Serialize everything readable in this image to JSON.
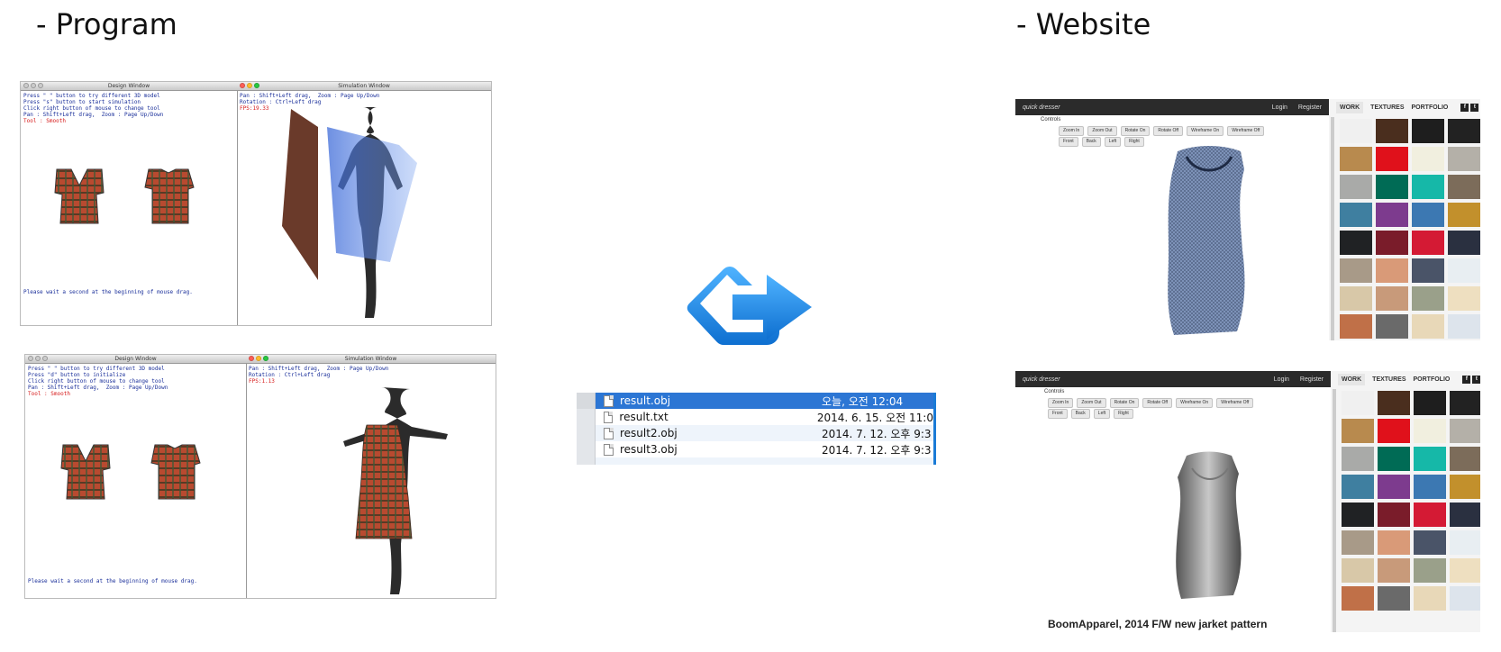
{
  "headings": {
    "program": "- Program",
    "website": "- Website"
  },
  "program_windows": [
    {
      "design_title": "Design Window",
      "design_lines": [
        "Press \" \" button to try different 3D model",
        "Press \"s\" button to start simulation",
        "Click right button of mouse to change tool",
        "Pan : Shift+Left drag,  Zoom : Page Up/Down"
      ],
      "tool_line": "Tool : Smooth",
      "footer": "Please wait a second at the beginning of mouse drag.",
      "sim_title": "Simulation Window",
      "sim_lines": [
        "Pan : Shift+Left drag,  Zoom : Page Up/Down",
        "Rotation : Ctrl+Left drag"
      ],
      "fps": "FPS:19.33"
    },
    {
      "design_title": "Design Window",
      "design_lines": [
        "Press \" \" button to try different 3D model",
        "Press \"d\" button to initialize",
        "Click right button of mouse to change tool",
        "Pan : Shift+Left drag,  Zoom : Page Up/Down"
      ],
      "tool_line": "Tool : Smooth",
      "footer": "Please wait a second at the beginning of mouse drag.",
      "sim_title": "Simulation Window",
      "sim_lines": [
        "Pan : Shift+Left drag,  Zoom : Page Up/Down",
        "Rotation : Ctrl+Left drag"
      ],
      "fps": "FPS:1.13"
    }
  ],
  "files": [
    {
      "name": "result.obj",
      "date": "오늘, 오전 12:04",
      "selected": true
    },
    {
      "name": "result.txt",
      "date": "2014. 6. 15. 오전 11:0"
    },
    {
      "name": "result2.obj",
      "date": "2014. 7. 12. 오후 9:3"
    },
    {
      "name": "result3.obj",
      "date": "2014. 7. 12. 오후 9:3"
    }
  ],
  "website": {
    "brand": "quick dresser",
    "login": "Login",
    "register": "Register",
    "controls_label": "Controls",
    "controls_row1": [
      "Zoom In",
      "Zoom Out",
      "Rotate On",
      "Rotate Off",
      "Wireframe On",
      "Wireframe Off"
    ],
    "controls_row2": [
      "Front",
      "Back",
      "Left",
      "Right"
    ],
    "nav": [
      "WORK",
      "TEXTURES",
      "PORTFOLIO"
    ],
    "social": [
      "f",
      "t"
    ],
    "swatches": [
      "#f0f0f0",
      "#4a2e1e",
      "#1e1e1e",
      "#222222",
      "#b88a4e",
      "#e0111b",
      "#f1efdf",
      "#b4b0a8",
      "#a9aaa8",
      "#006b55",
      "#16b8a8",
      "#7c6c5a",
      "#3f7fa0",
      "#7d3b8e",
      "#3c78b2",
      "#c2902c",
      "#202224",
      "#7a1c2a",
      "#d41a34",
      "#2a3040",
      "#a89a88",
      "#d99a78",
      "#4a5468",
      "#e8eef2",
      "#d8c8a8",
      "#c89a7a",
      "#9aa08a",
      "#eedfc0",
      "#c07048",
      "#6a6a6a",
      "#e8d8b8",
      "#dde4ec"
    ],
    "caption": "BoomApparel, 2014 F/W new jarket pattern"
  },
  "colors": {
    "accent_blue": "#2c76d4",
    "link_blue": "#1a2f9a",
    "status_red": "#d61a1a"
  },
  "icons": [
    "transfer-arrow-icon",
    "file-icon",
    "facebook-icon",
    "twitter-icon"
  ]
}
